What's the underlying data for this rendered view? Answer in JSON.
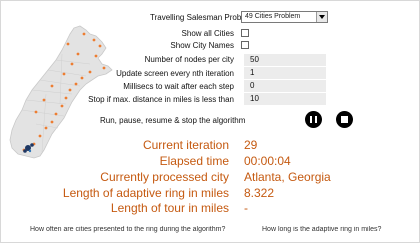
{
  "controls": {
    "problem_label": "Travelling Salesman Problem",
    "problem_value": "49 Cities Problem",
    "show_all_cities_label": "Show all Cities",
    "show_city_names_label": "Show City Names",
    "nodes_per_city_label": "Number of nodes per city",
    "nodes_per_city_value": "50",
    "update_screen_label": "Update screen every nth iteration",
    "update_screen_value": "1",
    "millisecs_label": "Millisecs to wait after each step",
    "millisecs_value": "0",
    "stop_distance_label": "Stop if max. distance in miles is less than",
    "stop_distance_value": "10",
    "run_label": "Run, pause, resume & stop the algorithm"
  },
  "stats": {
    "current_iteration_label": "Current iteration",
    "current_iteration_value": "29",
    "elapsed_time_label": "Elapsed time",
    "elapsed_time_value": "00:00:04",
    "current_city_label": "Currently processed city",
    "current_city_value": "Atlanta, Georgia",
    "ring_length_label": "Length of adaptive ring in miles",
    "ring_length_value": "8.322",
    "tour_length_label": "Length of tour in miles",
    "tour_length_value": "-"
  },
  "footer": {
    "left_text": "How often are cities presented to the ring during the algorithm?",
    "right_text": "How long is the adaptive ring in miles?"
  },
  "colors": {
    "accent": "#c55a11",
    "map_fill": "#e3e3e3",
    "city_dot": "#ed7d31",
    "ring": "#1f3864"
  }
}
